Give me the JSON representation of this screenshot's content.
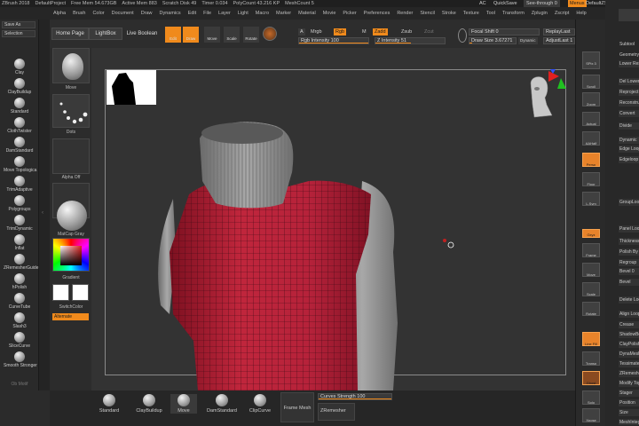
{
  "titlebar": {
    "items": [
      "ZBrush 2018",
      "DefaultProject",
      "Free Mem 54.673GB",
      "Active Mem 883",
      "Scratch Disk 49",
      "Timer 0.034",
      "PolyCount 43.216 KP",
      "MeshCount 5"
    ],
    "ac": "AC",
    "quicksave": "QuickSave",
    "seethrough": "See-through 0",
    "menus": "Menus",
    "script": "DefaultZScript"
  },
  "menubar": {
    "items": [
      "Alpha",
      "Brush",
      "Color",
      "Document",
      "Draw",
      "Dynamics",
      "Edit",
      "File",
      "Layer",
      "Light",
      "Macro",
      "Marker",
      "Material",
      "Movie",
      "Picker",
      "Preferences",
      "Render",
      "Stencil",
      "Stroke",
      "Texture",
      "Tool",
      "Transform",
      "Zplugin",
      "Zscript",
      "Help"
    ]
  },
  "leftshelf": {
    "buttons": [
      "Save As",
      "Selection"
    ],
    "brushes": [
      "Clay",
      "ClayBuildup",
      "Standard",
      "ClothTwister",
      "DamStandard",
      "Move Topologica",
      "TrimAdaptive",
      "Polygroups",
      "TrimDynamic",
      "Inflat",
      "ZRemesherGuide",
      "hPolish",
      "CurveTube",
      "Slash3",
      "SliceCurve",
      "Smooth Stronger"
    ],
    "footer": "Ob Motif"
  },
  "toolpal": {
    "move": "Move",
    "dots": "Dots",
    "alpha_off": "Alpha Off",
    "texture_off": "Texture Off",
    "matcap": "MatCap Gray",
    "gradient": "Gradient",
    "switchcolor": "SwitchColor",
    "alternate": "Alternate"
  },
  "toptoolbar": {
    "home": "Home Page",
    "lightbox": "LightBox",
    "liveboolean": "Live Boolean",
    "edit": "Edit",
    "draw": "Draw",
    "move": "Move",
    "scale": "Scale",
    "rotate": "Rotate",
    "a": "A",
    "mrgb": "Mrgb",
    "rgb": "Rgb",
    "m": "M",
    "zadd": "Zadd",
    "zsub": "Zsub",
    "zcut": "Zcut",
    "rgb_intensity": "Rgb Intensity 100",
    "z_intensity": "Z Intensity 51",
    "focal_shift": "Focal Shift 0",
    "draw_size": "Draw Size 3.67271",
    "dynamic": "Dynamic",
    "replaylast": "ReplayLast",
    "adjustlast": "AdjustLast 1"
  },
  "rightshelf": {
    "buttons": [
      "SPix 3",
      "Scroll",
      "Zoom",
      "Actual",
      "AAHalf",
      "Persp",
      "Floor",
      "L.Sym",
      "Gxyz",
      "Frame",
      "Move",
      "Scale",
      "Rotate",
      "Line Fill",
      "Transp",
      "Ghost",
      "Solo",
      "Xpose"
    ]
  },
  "rightpanel": {
    "items": [
      "Subtool",
      "Geometry",
      "Lower Res",
      "Del Lower",
      "Reproject",
      "Reconstruct",
      "Convert",
      "Divide",
      "Dynamic",
      "Edge Loop",
      "Edgeloop",
      "GroupLoops",
      "Panel Loops",
      "Thickness",
      "Polish By",
      "Regroup",
      "Bevel 0",
      "Bevel",
      "Delete Loops",
      "Align Loops",
      "Crease",
      "ShadowBox",
      "ClayPolish",
      "DynaMesh",
      "Tessimate",
      "ZRemesher",
      "Modify Topology",
      "Stager",
      "Position",
      "Size",
      "MeshIntegrity"
    ]
  },
  "bottombar": {
    "brushes": [
      "Standard",
      "ClayBuildup",
      "Move",
      "DamStandard",
      "ClipCurve"
    ],
    "framemesh": "Frame Mesh",
    "curves_strength": "Curves Strength 100",
    "zremesher": "ZRemesher"
  },
  "colors": {
    "accent": "#f08a1c",
    "sweater_red": "#b8283c",
    "sweater_gray": "#9a9a9a"
  }
}
